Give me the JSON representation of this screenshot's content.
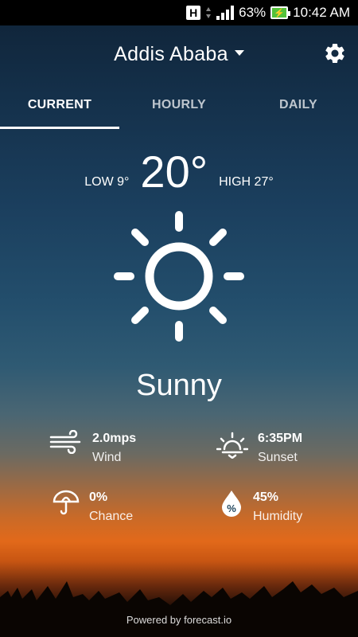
{
  "status_bar": {
    "network_badge": "H",
    "battery": "63%",
    "time": "10:42 AM",
    "battery_color": "#53c23a"
  },
  "header": {
    "city": "Addis Ababa",
    "settings_icon": "gear-icon"
  },
  "tabs": [
    {
      "label": "CURRENT",
      "active": true
    },
    {
      "label": "HOURLY",
      "active": false
    },
    {
      "label": "DAILY",
      "active": false
    }
  ],
  "current": {
    "low": "LOW 9°",
    "temp": "20°",
    "high": "HIGH 27°",
    "icon": "sun-icon",
    "condition": "Sunny"
  },
  "details": {
    "wind": {
      "value": "2.0mps",
      "label": "Wind",
      "icon": "wind-icon"
    },
    "sunset": {
      "value": "6:35PM",
      "label": "Sunset",
      "icon": "sunset-icon"
    },
    "chance": {
      "value": "0%",
      "label": "Chance",
      "icon": "umbrella-icon"
    },
    "humidity": {
      "value": "45%",
      "label": "Humidity",
      "icon": "humidity-drop-icon"
    }
  },
  "footer": "Powered by forecast.io"
}
